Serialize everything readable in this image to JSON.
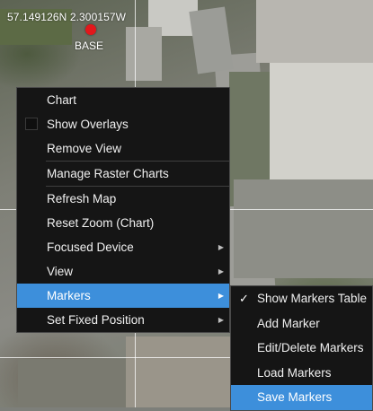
{
  "map": {
    "coordinate_text": "57.149126N 2.300157W",
    "marker_label": "BASE",
    "marker_color": "#e2171b"
  },
  "context_menu": {
    "items": [
      {
        "label": "Chart",
        "has_checkbox": false,
        "has_submenu": false
      },
      {
        "label": "Show Overlays",
        "has_checkbox": true,
        "checked": false,
        "has_submenu": false
      },
      {
        "label": "Remove View",
        "has_checkbox": false,
        "has_submenu": false
      },
      {
        "label": "Manage Raster Charts",
        "has_checkbox": false,
        "has_submenu": false
      },
      {
        "label": "Refresh Map",
        "has_checkbox": false,
        "has_submenu": false
      },
      {
        "label": "Reset Zoom (Chart)",
        "has_checkbox": false,
        "has_submenu": false
      },
      {
        "label": "Focused Device",
        "has_checkbox": false,
        "has_submenu": true
      },
      {
        "label": "View",
        "has_checkbox": false,
        "has_submenu": true
      },
      {
        "label": "Markers",
        "has_checkbox": false,
        "has_submenu": true,
        "highlighted": true
      },
      {
        "label": "Set Fixed Position",
        "has_checkbox": false,
        "has_submenu": true
      }
    ],
    "submenu_arrow_icon": "chevron-right-icon",
    "highlight_color": "#3d8fdb"
  },
  "markers_submenu": {
    "items": [
      {
        "label": "Show Markers Table",
        "checked": true
      },
      {
        "label": "Add Marker"
      },
      {
        "label": "Edit/Delete Markers"
      },
      {
        "label": "Load Markers"
      },
      {
        "label": "Save Markers",
        "highlighted": true
      }
    ],
    "check_icon": "checkmark-icon"
  }
}
